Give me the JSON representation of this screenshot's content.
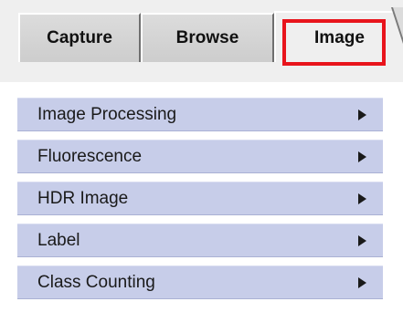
{
  "tabs": [
    {
      "label": "Capture",
      "active": false
    },
    {
      "label": "Browse",
      "active": false
    },
    {
      "label": "Image",
      "active": true
    }
  ],
  "menu": {
    "items": [
      {
        "label": "Image Processing",
        "icon": "submenu-arrow-icon"
      },
      {
        "label": "Fluorescence",
        "icon": "submenu-arrow-icon"
      },
      {
        "label": "HDR Image",
        "icon": "submenu-arrow-icon"
      },
      {
        "label": "Label",
        "icon": "submenu-arrow-icon"
      },
      {
        "label": "Class Counting",
        "icon": "submenu-arrow-icon"
      }
    ]
  },
  "colors": {
    "highlight": "#e8141c",
    "menu_item_bg": "#c7cde9",
    "tab_bar_bg": "#efefef"
  }
}
